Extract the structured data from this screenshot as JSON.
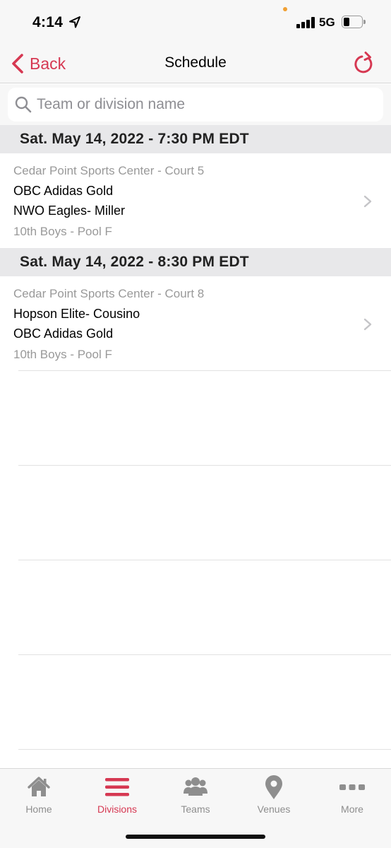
{
  "status_bar": {
    "time": "4:14",
    "network": "5G"
  },
  "nav": {
    "back_label": "Back",
    "title": "Schedule"
  },
  "search": {
    "placeholder": "Team or division name",
    "value": ""
  },
  "sections": [
    {
      "header": "Sat. May 14, 2022 - 7:30 PM EDT",
      "game": {
        "venue": "Cedar Point Sports Center - Court 5",
        "team1": "OBC Adidas Gold",
        "team2": "NWO Eagles- Miller",
        "division": "10th Boys - Pool F"
      }
    },
    {
      "header": "Sat. May 14, 2022 - 8:30 PM EDT",
      "game": {
        "venue": "Cedar Point Sports Center - Court 8",
        "team1": "Hopson Elite- Cousino",
        "team2": "OBC Adidas Gold",
        "division": "10th Boys - Pool F"
      }
    }
  ],
  "tabs": [
    {
      "label": "Home",
      "icon": "home-icon",
      "active": false
    },
    {
      "label": "Divisions",
      "icon": "list-icon",
      "active": true
    },
    {
      "label": "Teams",
      "icon": "people-icon",
      "active": false
    },
    {
      "label": "Venues",
      "icon": "map-pin-icon",
      "active": false
    },
    {
      "label": "More",
      "icon": "ellipsis-icon",
      "active": false
    }
  ],
  "colors": {
    "accent": "#d63852",
    "inactive": "#8e8e8e",
    "section_bg": "#e8e8ea",
    "bar_bg": "#f7f7f7"
  }
}
